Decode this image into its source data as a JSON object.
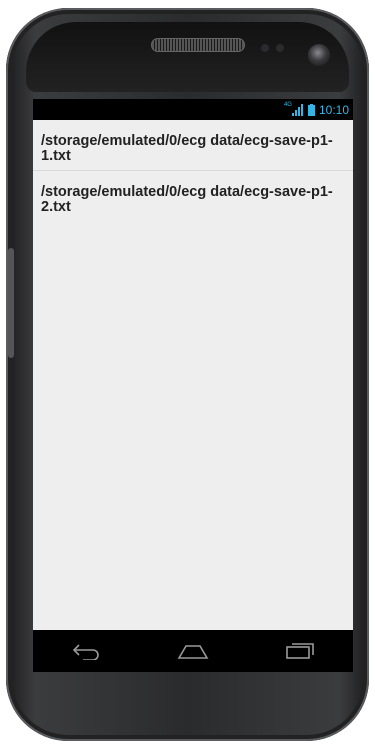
{
  "status_bar": {
    "network_label": "4G",
    "time": "10:10"
  },
  "files": [
    {
      "path": "/storage/emulated/0/ecg data/ecg-save-p1-1.txt"
    },
    {
      "path": "/storage/emulated/0/ecg data/ecg-save-p1-2.txt"
    }
  ],
  "nav": {
    "back_icon": "back-icon",
    "home_icon": "home-icon",
    "recents_icon": "recents-icon"
  },
  "colors": {
    "accent": "#33b5e5",
    "content_bg": "#eeeeee"
  }
}
